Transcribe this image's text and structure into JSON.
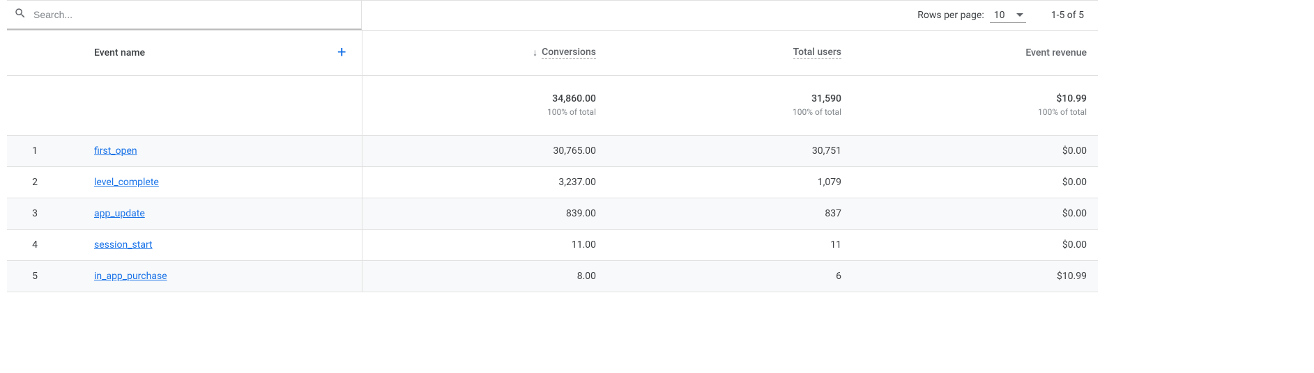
{
  "search": {
    "placeholder": "Search..."
  },
  "pager": {
    "rows_label": "Rows per page:",
    "rows_value": "10",
    "range": "1-5 of 5"
  },
  "columns": {
    "event_name": "Event name",
    "conversions": "Conversions",
    "total_users": "Total users",
    "event_revenue": "Event revenue"
  },
  "summary": {
    "conversions": {
      "value": "34,860.00",
      "pct": "100% of total"
    },
    "total_users": {
      "value": "31,590",
      "pct": "100% of total"
    },
    "event_revenue": {
      "value": "$10.99",
      "pct": "100% of total"
    }
  },
  "rows": [
    {
      "idx": "1",
      "name": "first_open",
      "conversions": "30,765.00",
      "total_users": "30,751",
      "event_revenue": "$0.00"
    },
    {
      "idx": "2",
      "name": "level_complete",
      "conversions": "3,237.00",
      "total_users": "1,079",
      "event_revenue": "$0.00"
    },
    {
      "idx": "3",
      "name": "app_update",
      "conversions": "839.00",
      "total_users": "837",
      "event_revenue": "$0.00"
    },
    {
      "idx": "4",
      "name": "session_start",
      "conversions": "11.00",
      "total_users": "11",
      "event_revenue": "$0.00"
    },
    {
      "idx": "5",
      "name": "in_app_purchase",
      "conversions": "8.00",
      "total_users": "6",
      "event_revenue": "$10.99"
    }
  ],
  "chart_data": {
    "type": "table",
    "columns": [
      "Event name",
      "Conversions",
      "Total users",
      "Event revenue"
    ],
    "rows": [
      [
        "first_open",
        30765.0,
        30751,
        0.0
      ],
      [
        "level_complete",
        3237.0,
        1079,
        0.0
      ],
      [
        "app_update",
        839.0,
        837,
        0.0
      ],
      [
        "session_start",
        11.0,
        11,
        0.0
      ],
      [
        "in_app_purchase",
        8.0,
        6,
        10.99
      ]
    ],
    "totals": {
      "Conversions": 34860.0,
      "Total users": 31590,
      "Event revenue": 10.99
    }
  }
}
